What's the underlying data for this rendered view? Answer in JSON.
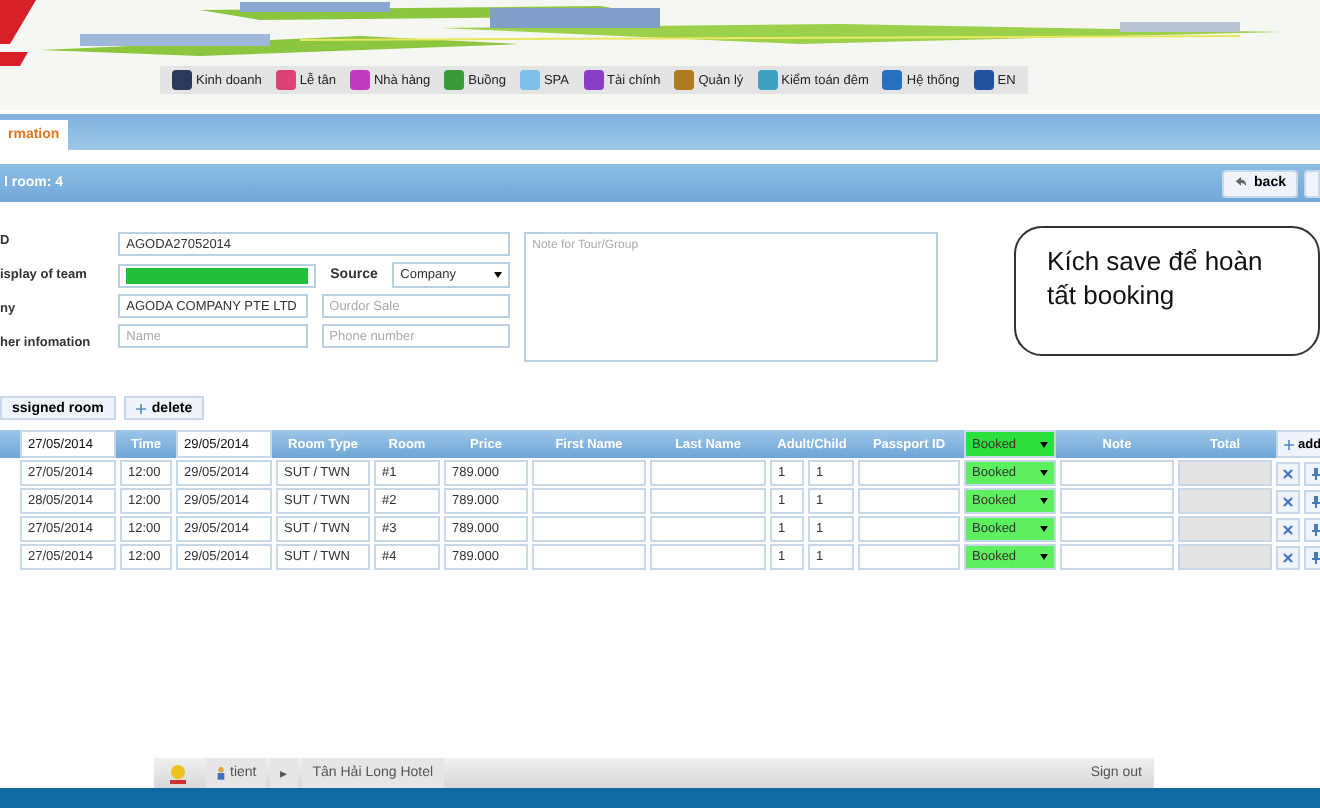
{
  "menu": [
    {
      "label": "Kinh doanh",
      "color": "#2b3a5c"
    },
    {
      "label": "Lễ tân",
      "color": "#e0407a"
    },
    {
      "label": "Nhà hàng",
      "color": "#c03bc0"
    },
    {
      "label": "Buồng",
      "color": "#3a9a3a"
    },
    {
      "label": "SPA",
      "color": "#7cc0e8"
    },
    {
      "label": "Tài chính",
      "color": "#8a3ec8"
    },
    {
      "label": "Quản lý",
      "color": "#b07a20"
    },
    {
      "label": "Kiểm toán đêm",
      "color": "#40a0c0"
    },
    {
      "label": "Hệ thống",
      "color": "#2a70c0"
    },
    {
      "label": "EN",
      "color": "#2050a0"
    }
  ],
  "tabs": [
    {
      "label": "rmation",
      "selected": true
    }
  ],
  "subbar": {
    "title": "l room: 4",
    "back": "back"
  },
  "form": {
    "labels": [
      "D",
      "isplay of team",
      "ny",
      "her infomation"
    ],
    "booking_id": "AGODA27052014",
    "team_display": {
      "color": "#22c03a"
    },
    "source_label": "Source",
    "source": "Company",
    "company": "AGODA COMPANY PTE LTD",
    "sale_placeholder": "Ourdor Sale",
    "name_placeholder": "Name",
    "phone_placeholder": "Phone number",
    "note_placeholder": "Note for Tour/Group"
  },
  "callout": {
    "lines": [
      "Kích save để hoàn",
      "tất booking"
    ]
  },
  "actions": [
    "ssigned room",
    "delete"
  ],
  "table": {
    "header": {
      "checkin": "27/05/2014",
      "time": "Time",
      "checkout": "29/05/2014",
      "columns": [
        "Room Type",
        "Room",
        "Price",
        "First Name",
        "Last Name",
        "Adult/Child",
        "Passport ID"
      ],
      "status": "Booked",
      "note": "Note",
      "total": "Total",
      "add": "add"
    },
    "rows": [
      {
        "checkin": "27/05/2014",
        "time": "12:00",
        "checkout": "29/05/2014",
        "room_type": "SUT / TWN",
        "room": "#1",
        "price": "789.000",
        "adult": "1",
        "child": "1",
        "status": "Booked"
      },
      {
        "checkin": "28/05/2014",
        "time": "12:00",
        "checkout": "29/05/2014",
        "room_type": "SUT / TWN",
        "room": "#2",
        "price": "789.000",
        "adult": "1",
        "child": "1",
        "status": "Booked"
      },
      {
        "checkin": "27/05/2014",
        "time": "12:00",
        "checkout": "29/05/2014",
        "room_type": "SUT / TWN",
        "room": "#3",
        "price": "789.000",
        "adult": "1",
        "child": "1",
        "status": "Booked"
      },
      {
        "checkin": "27/05/2014",
        "time": "12:00",
        "checkout": "29/05/2014",
        "room_type": "SUT / TWN",
        "room": "#4",
        "price": "789.000",
        "adult": "1",
        "child": "1",
        "status": "Booked"
      }
    ]
  },
  "footer": {
    "user": "tient",
    "separator": "▸",
    "hotel": "Tân Hải Long Hotel",
    "signout": "Sign out"
  }
}
